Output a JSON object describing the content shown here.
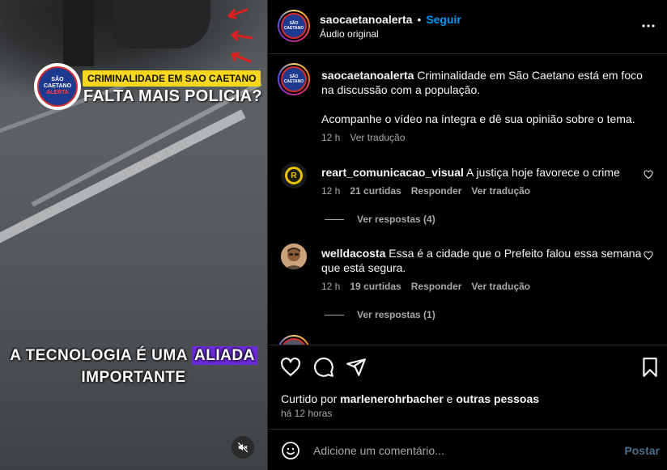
{
  "video": {
    "overlay_tag": "CRIMINALIDADE EM SAO CAETANO",
    "overlay_headline": "FALTA MAIS POLICIA?",
    "caption_line1_start": "A TECNOLOGIA É UMA ",
    "caption_line1_highlight": "ALIADA",
    "caption_line2": "IMPORTANTE",
    "logo_text_top": "SÃO CAETANO",
    "logo_text_bottom": "ALERTA",
    "mute_icon": "speaker-muted-icon"
  },
  "header": {
    "username": "saocaetanoalerta",
    "separator": "•",
    "follow_label": "Seguir",
    "audio_label": "Áudio original",
    "more_icon": "more-horizontal-icon"
  },
  "caption_post": {
    "username": "saocaetanoalerta",
    "text": "Criminalidade em São Caetano está em foco na discussão com a população.",
    "text2": "Acompanhe o vídeo na íntegra e dê sua opinião sobre o tema.",
    "time": "12 h",
    "translate": "Ver tradução"
  },
  "comments": [
    {
      "username": "reart_comunicacao_visual",
      "text": "A justiça hoje favorece o crime",
      "time": "12 h",
      "likes": "21 curtidas",
      "reply": "Responder",
      "translate": "Ver tradução",
      "view_replies": "Ver respostas (4)"
    },
    {
      "username": "welldacosta",
      "text": "Essa é a cidade que o Prefeito falou essa semana que está segura.",
      "time": "12 h",
      "likes": "19 curtidas",
      "reply": "Responder",
      "translate": "Ver tradução",
      "view_replies": "Ver respostas (1)"
    }
  ],
  "actions": {
    "liked_by_prefix": "Curtido por ",
    "liked_by_user": "marlenerohrbacher",
    "liked_by_mid": " e ",
    "liked_by_rest": "outras pessoas",
    "time_ago": "há 12 horas"
  },
  "add_comment": {
    "placeholder": "Adicione um comentário...",
    "post_label": "Postar"
  },
  "colors": {
    "accent": "#0095f6",
    "tag_yellow": "#f8d71c",
    "highlight_purple": "#6d2bd9",
    "arrow_red": "#e02020"
  }
}
